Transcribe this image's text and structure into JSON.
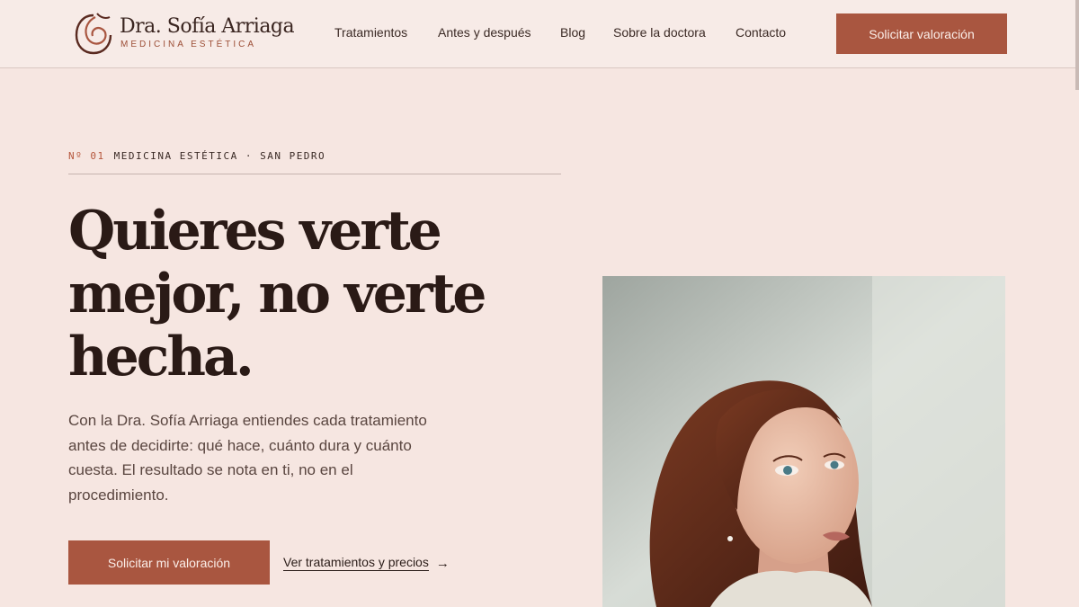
{
  "brand": {
    "name": "Dra. Sofía Arriaga",
    "tagline": "MEDICINA ESTÉTICA"
  },
  "nav": {
    "items": [
      "Tratamientos",
      "Antes y después",
      "Blog",
      "Sobre la doctora",
      "Contacto"
    ],
    "cta": "Solicitar valoración"
  },
  "hero": {
    "eyebrow_number": "Nº 01",
    "eyebrow_text": "MEDICINA ESTÉTICA · SAN PEDRO",
    "headline": "Quieres verte mejor, no verte hecha.",
    "intro": "Con la Dra. Sofía Arriaga entiendes cada tratamiento antes de decidirte: qué hace, cuánto dura y cuánto cuesta. El resultado se nota en ti, no en el procedimiento.",
    "primary_cta": "Solicitar mi valoración",
    "secondary_link": "Ver tratamientos y precios"
  },
  "icons": {
    "arrow": "arrow-right-icon",
    "logo": "logo-mark-icon"
  },
  "colors": {
    "accent": "#a95640",
    "background": "#f6e6e1",
    "text": "#2a1c18"
  }
}
